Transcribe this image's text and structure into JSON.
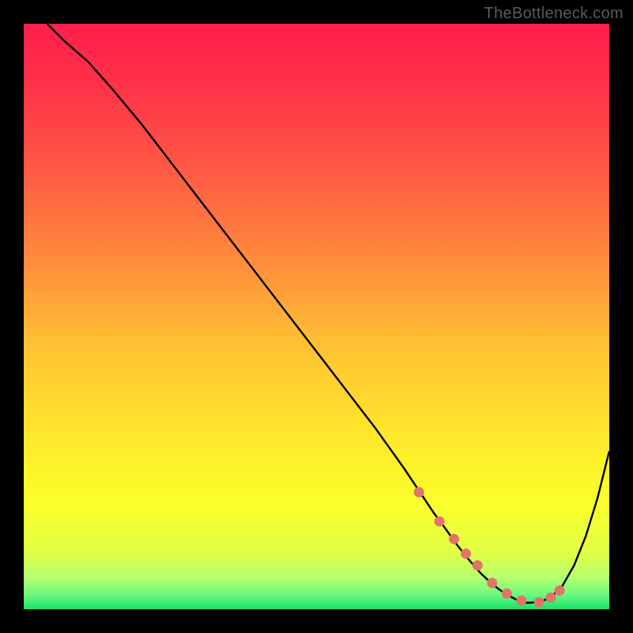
{
  "watermark": "TheBottleneck.com",
  "chart_data": {
    "type": "line",
    "title": "",
    "xlabel": "",
    "ylabel": "",
    "xlim": [
      0,
      100
    ],
    "ylim": [
      0,
      100
    ],
    "series": [
      {
        "name": "curve",
        "x": [
          4,
          7,
          11,
          15,
          20,
          25,
          30,
          35,
          40,
          45,
          50,
          55,
          60,
          65,
          68,
          70,
          72,
          74,
          76,
          78,
          80,
          82,
          84,
          86,
          88,
          90,
          92,
          94,
          96,
          98,
          100
        ],
        "y": [
          100,
          97,
          93.5,
          89,
          83,
          76.5,
          70,
          63.5,
          57,
          50.5,
          44,
          37.5,
          31,
          24,
          19.5,
          16.5,
          13.8,
          11,
          8.5,
          6.2,
          4.3,
          2.8,
          1.7,
          1.1,
          1.2,
          2.0,
          4.0,
          7.5,
          12.5,
          19,
          27
        ]
      }
    ],
    "markers": {
      "name": "optimal-region",
      "x": [
        67.5,
        71,
        73.5,
        75.5,
        77.5,
        80,
        82.5,
        85,
        88,
        90,
        91.5
      ],
      "y": [
        20,
        15,
        12,
        9.5,
        7.5,
        4.5,
        2.7,
        1.5,
        1.2,
        2.0,
        3.2
      ]
    },
    "background_gradient": {
      "stops": [
        {
          "offset": 0.0,
          "color": "#ff1f4b"
        },
        {
          "offset": 0.1,
          "color": "#ff3049"
        },
        {
          "offset": 0.25,
          "color": "#ff5a44"
        },
        {
          "offset": 0.4,
          "color": "#ff8a3c"
        },
        {
          "offset": 0.55,
          "color": "#ffc133"
        },
        {
          "offset": 0.7,
          "color": "#ffe72c"
        },
        {
          "offset": 0.82,
          "color": "#fbff2a"
        },
        {
          "offset": 0.9,
          "color": "#e3ff43"
        },
        {
          "offset": 0.945,
          "color": "#b8ff6e"
        },
        {
          "offset": 0.975,
          "color": "#6cf97f"
        },
        {
          "offset": 1.0,
          "color": "#17e36a"
        }
      ]
    },
    "colors": {
      "curve": "#000000",
      "marker": "#e2746a",
      "frame": "#000000"
    }
  }
}
